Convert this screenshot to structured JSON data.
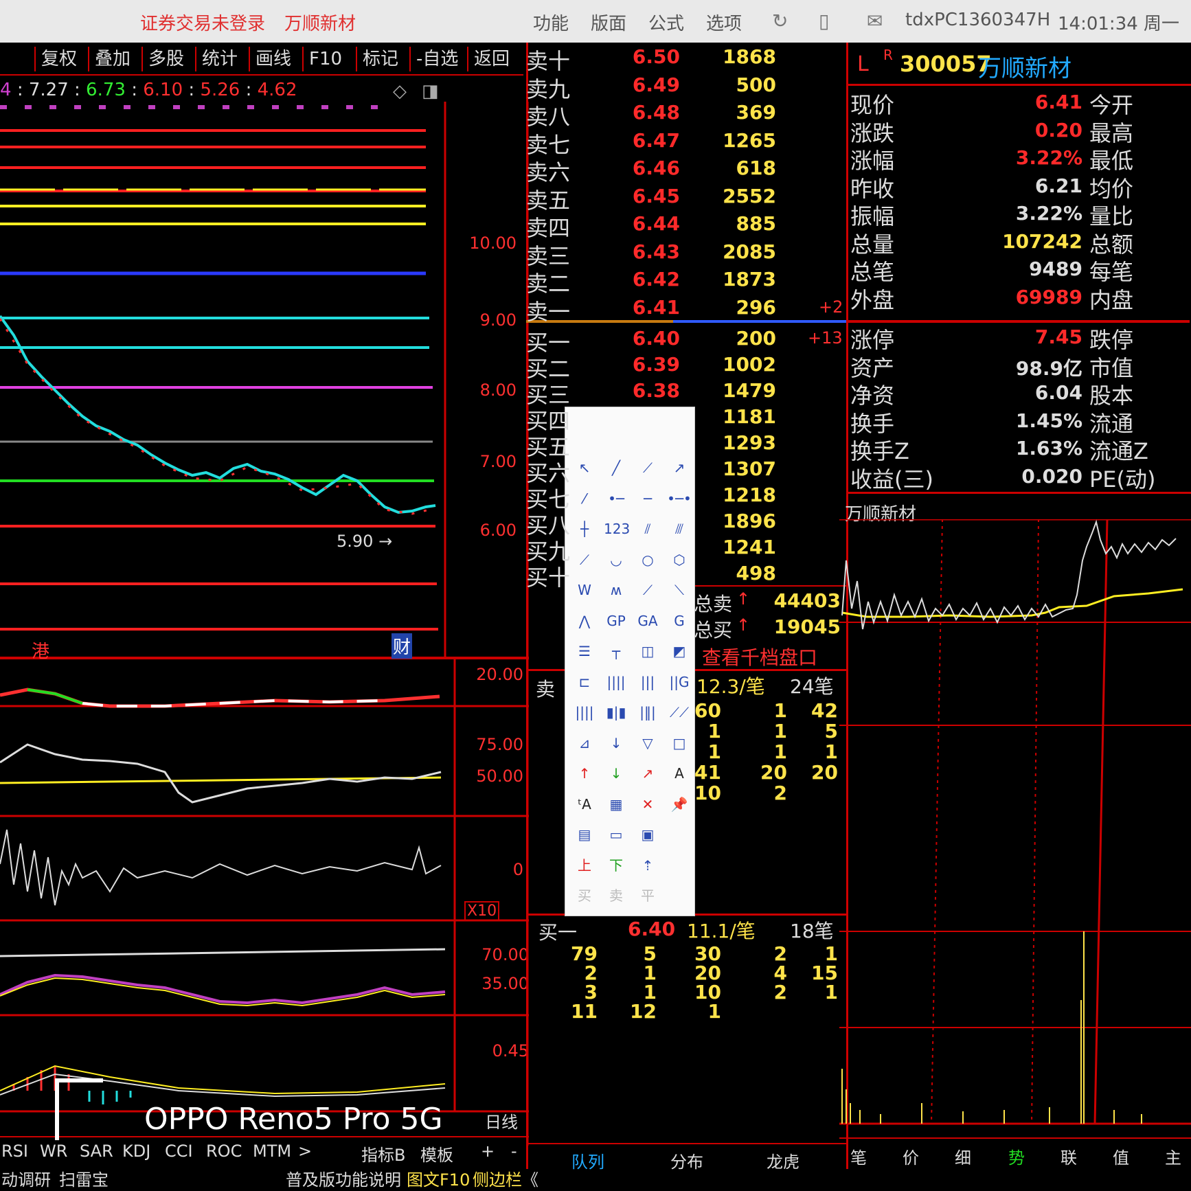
{
  "topbar": {
    "login_status": "证券交易未登录",
    "stock_name": "万顺新材",
    "menu": [
      "功能",
      "版面",
      "公式",
      "选项"
    ],
    "user_id": "tdxPC1360347H",
    "clock": "14:01:34 周一"
  },
  "toolbar": [
    "复权",
    "叠加",
    "多股",
    "统计",
    "画线",
    "F10",
    "标记",
    "-自选",
    "返回"
  ],
  "ma_values": [
    "4",
    "7.27",
    "6.73",
    "6.10",
    "5.26",
    "4.62"
  ],
  "chart": {
    "price_axis": [
      "10.00",
      "9.00",
      "8.00",
      "7.00",
      "6.00"
    ],
    "low_marker": "5.90",
    "badge_gang": "港",
    "badge_cai": "财",
    "ind1_axis": [
      "20.00"
    ],
    "ind2_axis": [
      "75.00",
      "50.00"
    ],
    "ind3_axis": [
      "0"
    ],
    "ind3_mult": "X10",
    "ind4_axis": [
      "70.00",
      "35.00"
    ],
    "ind5_axis": [
      "0.45"
    ],
    "period": "日线",
    "indicator_tabs": [
      "RSI",
      "WR",
      "SAR",
      "KDJ",
      "CCI",
      "ROC",
      "MTM",
      ">"
    ],
    "indicator_extra": [
      "指标B",
      "模板",
      "+",
      "-"
    ],
    "bottom_left": [
      "动调研",
      "扫雷宝"
    ],
    "bottom_mid": [
      "普及版功能说明",
      "图文F10",
      "侧边栏",
      "《"
    ]
  },
  "order_book": {
    "asks": [
      {
        "label": "卖十",
        "price": "6.50",
        "vol": "1868"
      },
      {
        "label": "卖九",
        "price": "6.49",
        "vol": "500"
      },
      {
        "label": "卖八",
        "price": "6.48",
        "vol": "369"
      },
      {
        "label": "卖七",
        "price": "6.47",
        "vol": "1265"
      },
      {
        "label": "卖六",
        "price": "6.46",
        "vol": "618"
      },
      {
        "label": "卖五",
        "price": "6.45",
        "vol": "2552"
      },
      {
        "label": "卖四",
        "price": "6.44",
        "vol": "885"
      },
      {
        "label": "卖三",
        "price": "6.43",
        "vol": "2085"
      },
      {
        "label": "卖二",
        "price": "6.42",
        "vol": "1873"
      },
      {
        "label": "卖一",
        "price": "6.41",
        "vol": "296",
        "delta": "+2"
      }
    ],
    "bids": [
      {
        "label": "买一",
        "price": "6.40",
        "vol": "200",
        "delta": "+13"
      },
      {
        "label": "买二",
        "price": "6.39",
        "vol": "1002"
      },
      {
        "label": "买三",
        "price": "6.38",
        "vol": "1479"
      },
      {
        "label": "买四",
        "price": "",
        "vol": "1181"
      },
      {
        "label": "买五",
        "price": "",
        "vol": "1293"
      },
      {
        "label": "买六",
        "price": "",
        "vol": "1307"
      },
      {
        "label": "买七",
        "price": "",
        "vol": "1218"
      },
      {
        "label": "买八",
        "price": "",
        "vol": "1896"
      },
      {
        "label": "买九",
        "price": "",
        "vol": "1241"
      },
      {
        "label": "买十",
        "price": "",
        "vol": "498"
      }
    ],
    "total_sell_label": "总卖",
    "total_sell": "44403",
    "total_buy_label": "总买",
    "total_buy": "19045",
    "view_link": "查看千档盘口",
    "sell_queue": {
      "label": "卖",
      "avg": "12.3/笔",
      "count": "24笔",
      "rows": [
        [
          "60",
          "1",
          "42"
        ],
        [
          "1",
          "1",
          "5"
        ],
        [
          "1",
          "1",
          "1"
        ],
        [
          "41",
          "20",
          "20"
        ],
        [
          "10",
          "2",
          ""
        ]
      ]
    },
    "buy_queue": {
      "label": "买一",
      "price": "6.40",
      "avg": "11.1/笔",
      "count": "18笔",
      "rows": [
        [
          "79",
          "5",
          "30",
          "2",
          "1"
        ],
        [
          "2",
          "1",
          "20",
          "4",
          "15"
        ],
        [
          "3",
          "1",
          "10",
          "2",
          "1"
        ],
        [
          "11",
          "12",
          "1",
          "",
          ""
        ]
      ]
    },
    "bottom_tabs": [
      "队列",
      "分布",
      "龙虎"
    ]
  },
  "quote": {
    "flag": "L",
    "sup": "R",
    "code": "300057",
    "name": "万顺新材",
    "rows": [
      {
        "l": "现价",
        "v": "6.41",
        "r": "今开",
        "c": "red"
      },
      {
        "l": "涨跌",
        "v": "0.20",
        "r": "最高",
        "c": "red"
      },
      {
        "l": "涨幅",
        "v": "3.22%",
        "r": "最低",
        "c": "red"
      },
      {
        "l": "昨收",
        "v": "6.21",
        "r": "均价",
        "c": "white"
      },
      {
        "l": "振幅",
        "v": "3.22%",
        "r": "量比",
        "c": "white"
      },
      {
        "l": "总量",
        "v": "107242",
        "r": "总额",
        "c": "yellow"
      },
      {
        "l": "总笔",
        "v": "9489",
        "r": "每笔",
        "c": "white"
      },
      {
        "l": "外盘",
        "v": "69989",
        "r": "内盘",
        "c": "red"
      },
      {
        "l": "涨停",
        "v": "7.45",
        "r": "跌停",
        "c": "red"
      },
      {
        "l": "资产",
        "v": "98.9亿",
        "r": "市值",
        "c": "white"
      },
      {
        "l": "净资",
        "v": "6.04",
        "r": "股本",
        "c": "white"
      },
      {
        "l": "换手",
        "v": "1.45%",
        "r": "流通",
        "c": "white"
      },
      {
        "l": "换手Z",
        "v": "1.63%",
        "r": "流通Z",
        "c": "white"
      },
      {
        "l": "收益(三)",
        "v": "0.020",
        "r": "PE(动)",
        "c": "white"
      }
    ],
    "mini_title": "万顺新材",
    "bottom_tabs": [
      "笔",
      "价",
      "细",
      "势",
      "联",
      "值",
      "主"
    ]
  },
  "palette": {
    "rows": [
      [
        "cursor-arrow",
        "line",
        "ray",
        "arrow-line"
      ],
      [
        "segment",
        "dot-line",
        "horizontal-ray",
        "dot-segment"
      ],
      [
        "vertical-dot",
        "123",
        "parallel",
        "parallel-b"
      ],
      [
        "slant",
        "arc",
        "circle",
        "polygon"
      ],
      [
        "wave-w",
        "wave-m",
        "wave-up",
        "wave-down"
      ],
      [
        "mountain",
        "GP",
        "GA",
        "G"
      ],
      [
        "fib-h",
        "fib-t",
        "fan-left",
        "fan-right"
      ],
      [
        "channel",
        "bars-4",
        "bars-3",
        "bars-g"
      ],
      [
        "bars-many",
        "bars-blue",
        "bars-grid",
        "speed-lines"
      ],
      [
        "gann-fan",
        "down-v",
        "triangle",
        "rectangle"
      ],
      [
        "up-arrow",
        "down-arrow",
        "red-arrow",
        "A"
      ],
      [
        "text-A",
        "gray-box",
        "delete-x",
        "pin"
      ],
      [
        "note",
        "ruler",
        "image"
      ],
      [
        "上",
        "下",
        "mark"
      ],
      [
        "买",
        "卖",
        "平"
      ]
    ]
  },
  "watermark": "OPPO Reno5 Pro 5G",
  "colors": {
    "red": "#ff2a2a",
    "yellow": "#ffe34a",
    "cyan": "#22dddd",
    "grid": "#c00000"
  }
}
